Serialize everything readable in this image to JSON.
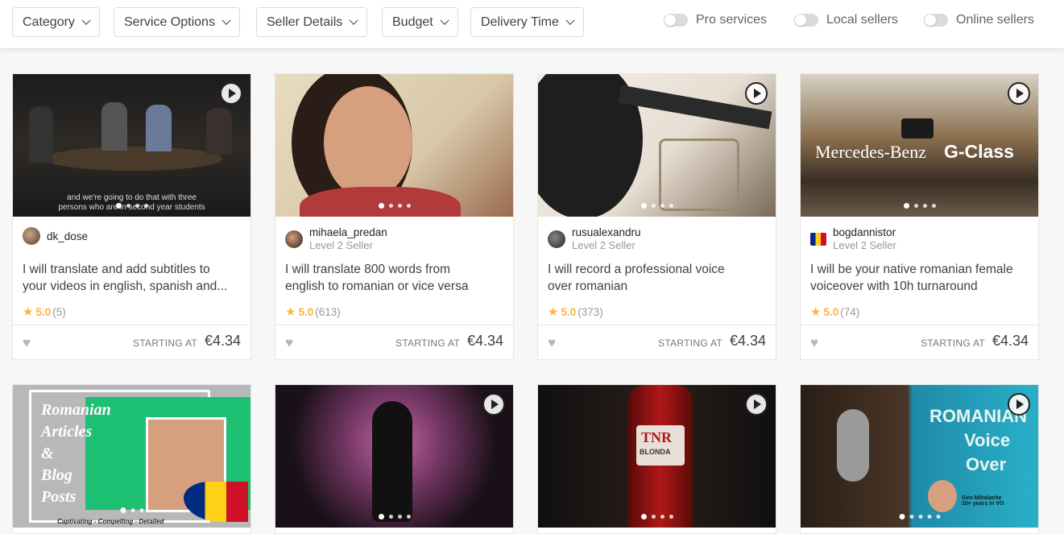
{
  "filters": [
    {
      "label": "Category"
    },
    {
      "label": "Service Options"
    },
    {
      "label": "Seller Details"
    },
    {
      "label": "Budget"
    },
    {
      "label": "Delivery Time"
    }
  ],
  "toggles": [
    {
      "label": "Pro services"
    },
    {
      "label": "Local sellers"
    },
    {
      "label": "Online sellers"
    }
  ],
  "gigs": [
    {
      "seller": "dk_dose",
      "level": "",
      "title_line1": "I will translate and add subtitles to",
      "title_line2": "your videos in english, spanish and...",
      "rating": "5.0",
      "reviews": "(5)",
      "price_label": "STARTING AT",
      "price": "€4.34",
      "overlay_text1": "and we're going to do that with three",
      "overlay_text2": "persons who are in second year students"
    },
    {
      "seller": "mihaela_predan",
      "level": "Level 2 Seller",
      "title_line1": "I will translate 800 words from",
      "title_line2": "english to romanian or vice versa",
      "rating": "5.0",
      "reviews": "(613)",
      "price_label": "STARTING AT",
      "price": "€4.34"
    },
    {
      "seller": "rusualexandru",
      "level": "Level 2 Seller",
      "title_line1": "I will record a professional voice",
      "title_line2": "over romanian",
      "rating": "5.0",
      "reviews": "(373)",
      "price_label": "STARTING AT",
      "price": "€4.34"
    },
    {
      "seller": "bogdannistor",
      "level": "Level 2 Seller",
      "title_line1": "I will be your native romanian female",
      "title_line2": "voiceover with 10h turnaround",
      "rating": "5.0",
      "reviews": "(74)",
      "price_label": "STARTING AT",
      "price": "€4.34",
      "overlay_text1": "Mercedes-Benz",
      "overlay_text2": "G-Class"
    }
  ],
  "row2": [
    {
      "overlay": [
        "Romanian",
        "Articles",
        "&",
        "Blog",
        "Posts"
      ],
      "caption": "Captivating - Compelling - Detailed"
    },
    {
      "overlay": []
    },
    {
      "overlay": [
        "TNR",
        "BLONDA"
      ]
    },
    {
      "overlay": [
        "ROMANIAN",
        "Voice",
        "Over"
      ],
      "caption": "Geo Mihalache 10+ years in VO"
    }
  ],
  "colors": {
    "accent": "#1dbf73",
    "star": "#ffb33e",
    "border": "#e4e5e7",
    "text": "#404145"
  }
}
